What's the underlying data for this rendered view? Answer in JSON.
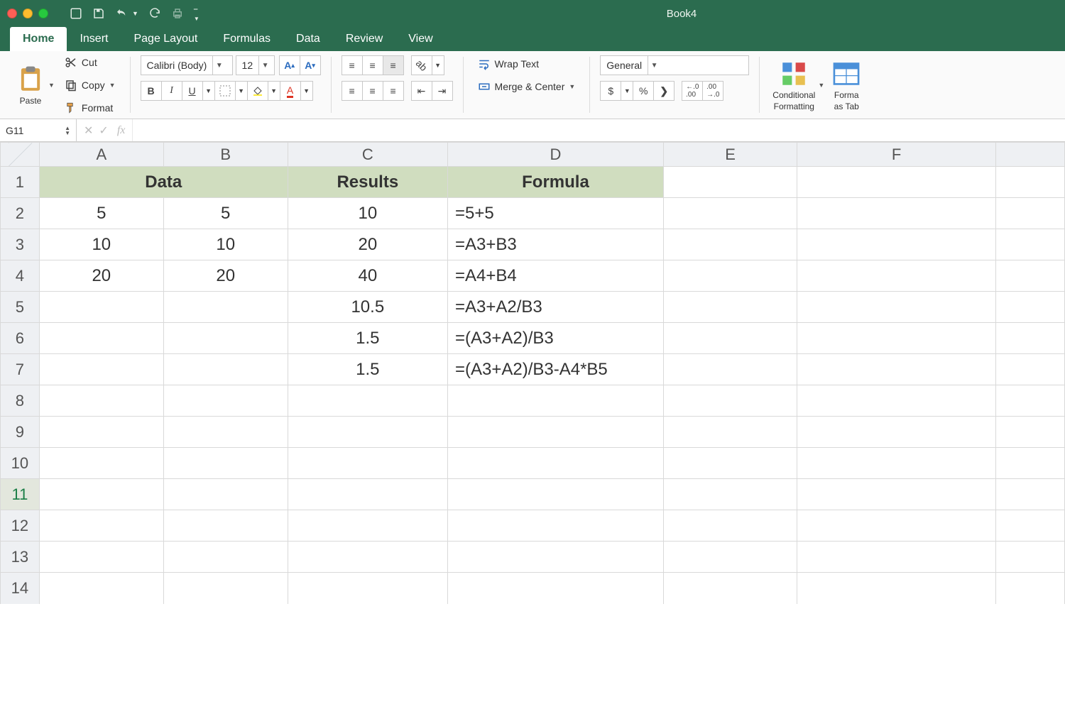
{
  "window": {
    "title": "Book4"
  },
  "tabs": {
    "home": "Home",
    "insert": "Insert",
    "pagelayout": "Page Layout",
    "formulas": "Formulas",
    "data": "Data",
    "review": "Review",
    "view": "View"
  },
  "ribbon": {
    "paste": "Paste",
    "cut": "Cut",
    "copy": "Copy",
    "format": "Format",
    "font": "Calibri (Body)",
    "size": "12",
    "wrap": "Wrap Text",
    "merge": "Merge & Center",
    "numfmt": "General",
    "condfmt": "Conditional",
    "condfmt2": "Formatting",
    "fmttab": "Forma",
    "fmttab2": "as Tab"
  },
  "fbar": {
    "name": "G11",
    "formula": ""
  },
  "cols": [
    "A",
    "B",
    "C",
    "D",
    "E",
    "F"
  ],
  "rows": [
    "1",
    "2",
    "3",
    "4",
    "5",
    "6",
    "7",
    "8",
    "9",
    "10",
    "11",
    "12",
    "13",
    "14"
  ],
  "chart_data": {
    "type": "table",
    "headers": {
      "AB": "Data",
      "C": "Results",
      "D": "Formula"
    },
    "cells": {
      "A2": "5",
      "B2": "5",
      "C2": "10",
      "D2": "=5+5",
      "A3": "10",
      "B3": "10",
      "C3": "20",
      "D3": "=A3+B3",
      "A4": "20",
      "B4": "20",
      "C4": "40",
      "D4": "=A4+B4",
      "C5": "10.5",
      "D5": "=A3+A2/B3",
      "C6": "1.5",
      "D6": "=(A3+A2)/B3",
      "C7": "1.5",
      "D7": "=(A3+A2)/B3-A4*B5"
    }
  }
}
